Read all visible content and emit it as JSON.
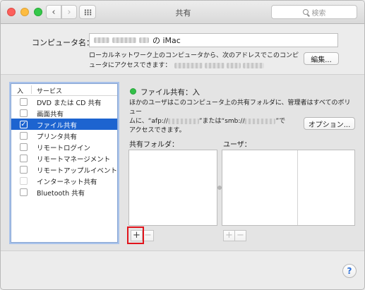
{
  "window": {
    "title": "共有",
    "search_placeholder": "検索"
  },
  "computer_name": {
    "label": "コンピュータ名：",
    "suffix": "の iMac",
    "local_description_line1": "ローカルネットワーク上のコンピュータから、次のアドレスでこのコンピ",
    "local_description_line2": "ュータにアクセスできます：",
    "edit_button": "編集..."
  },
  "services": {
    "header_on": "入",
    "header_service": "サービス",
    "items": [
      {
        "label": "DVD または CD 共有",
        "checked": false,
        "selected": false,
        "enabled": true
      },
      {
        "label": "画面共有",
        "checked": false,
        "selected": false,
        "enabled": true
      },
      {
        "label": "ファイル共有",
        "checked": true,
        "selected": true,
        "enabled": true
      },
      {
        "label": "プリンタ共有",
        "checked": false,
        "selected": false,
        "enabled": true
      },
      {
        "label": "リモートログイン",
        "checked": false,
        "selected": false,
        "enabled": true
      },
      {
        "label": "リモートマネージメント",
        "checked": false,
        "selected": false,
        "enabled": true
      },
      {
        "label": "リモートアップルイベント",
        "checked": false,
        "selected": false,
        "enabled": true
      },
      {
        "label": "インターネット共有",
        "checked": false,
        "selected": false,
        "enabled": false
      },
      {
        "label": "Bluetooth 共有",
        "checked": false,
        "selected": false,
        "enabled": true
      }
    ]
  },
  "file_sharing": {
    "status": "ファイル共有：入",
    "status_color": "#32c048",
    "description_line1": "ほかのユーザはこのコンピュータ上の共有フォルダに、管理者はすべてのボリュー",
    "description_line2a": "ムに、“afp://",
    "description_line2b": "”または“smb://",
    "description_line2c": "”で",
    "description_line3": "アクセスできます。",
    "options_button": "オプション...",
    "shared_folders_label": "共有フォルダ：",
    "users_label": "ユーザ：",
    "add_symbol": "+",
    "remove_symbol": "−"
  },
  "help": "?",
  "colors": {
    "selection": "#1d64d0",
    "highlight_box": "#e1141c"
  }
}
